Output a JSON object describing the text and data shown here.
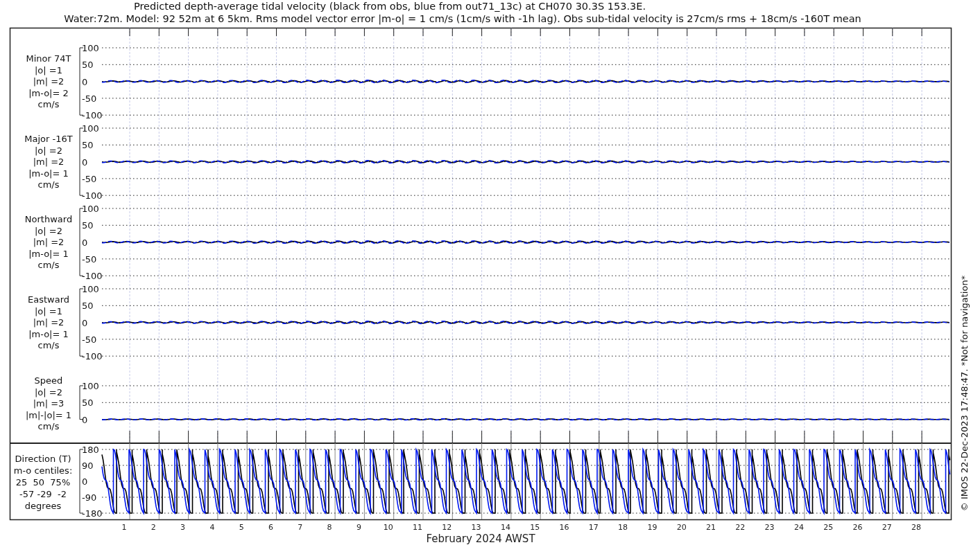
{
  "title_lines": [
    "Predicted depth-average tidal velocity (black from obs, blue from out71_13c) at CH070 30.3S 153.3E.",
    "Water:72m. Model: 92 52m at 6 5km. Rms model vector error |m-o| = 1 cm/s (1cm/s with -1h lag). Obs sub-tidal velocity is 27cm/s rms + 18cm/s -160T mean"
  ],
  "panels": [
    {
      "label_lines": [
        "Minor 74T",
        "|o| =1",
        "|m| =2",
        "|m-o|= 2",
        "cm/s"
      ],
      "yticks": [
        "100",
        "50",
        "0",
        "-50",
        "-100"
      ]
    },
    {
      "label_lines": [
        "Major -16T",
        "|o| =2",
        "|m| =2",
        "|m-o|= 1",
        "cm/s"
      ],
      "yticks": [
        "100",
        "50",
        "0",
        "-50",
        "-100"
      ]
    },
    {
      "label_lines": [
        "Northward",
        "|o| =2",
        "|m| =2",
        "|m-o|= 1",
        "cm/s"
      ],
      "yticks": [
        "100",
        "50",
        "0",
        "-50",
        "-100"
      ]
    },
    {
      "label_lines": [
        "Eastward",
        "|o| =1",
        "|m| =2",
        "|m-o|= 1",
        "cm/s"
      ],
      "yticks": [
        "100",
        "50",
        "0",
        "-50",
        "-100"
      ]
    },
    {
      "label_lines": [
        "Speed",
        "|o| =2",
        "|m| =3",
        "|m|-|o|= 1",
        "cm/s"
      ],
      "yticks": [
        "100",
        "50",
        "0"
      ]
    }
  ],
  "direction_panel": {
    "label_lines": [
      "Direction (T)",
      "m-o centiles:",
      "25  50  75%",
      "-57 -29  -2",
      "degrees"
    ],
    "yticks": [
      "180",
      "90",
      "0",
      "-90",
      "-180"
    ]
  },
  "x_axis": {
    "day_labels": [
      "1",
      "2",
      "3",
      "4",
      "5",
      "6",
      "7",
      "8",
      "9",
      "10",
      "11",
      "12",
      "13",
      "14",
      "15",
      "16",
      "17",
      "18",
      "19",
      "20",
      "21",
      "22",
      "23",
      "24",
      "25",
      "26",
      "27",
      "28"
    ],
    "xlabel": "February 2024 AWST"
  },
  "credit": "© IMOS 22-Dec-2023 17:48:47. *Not for navigation*"
}
